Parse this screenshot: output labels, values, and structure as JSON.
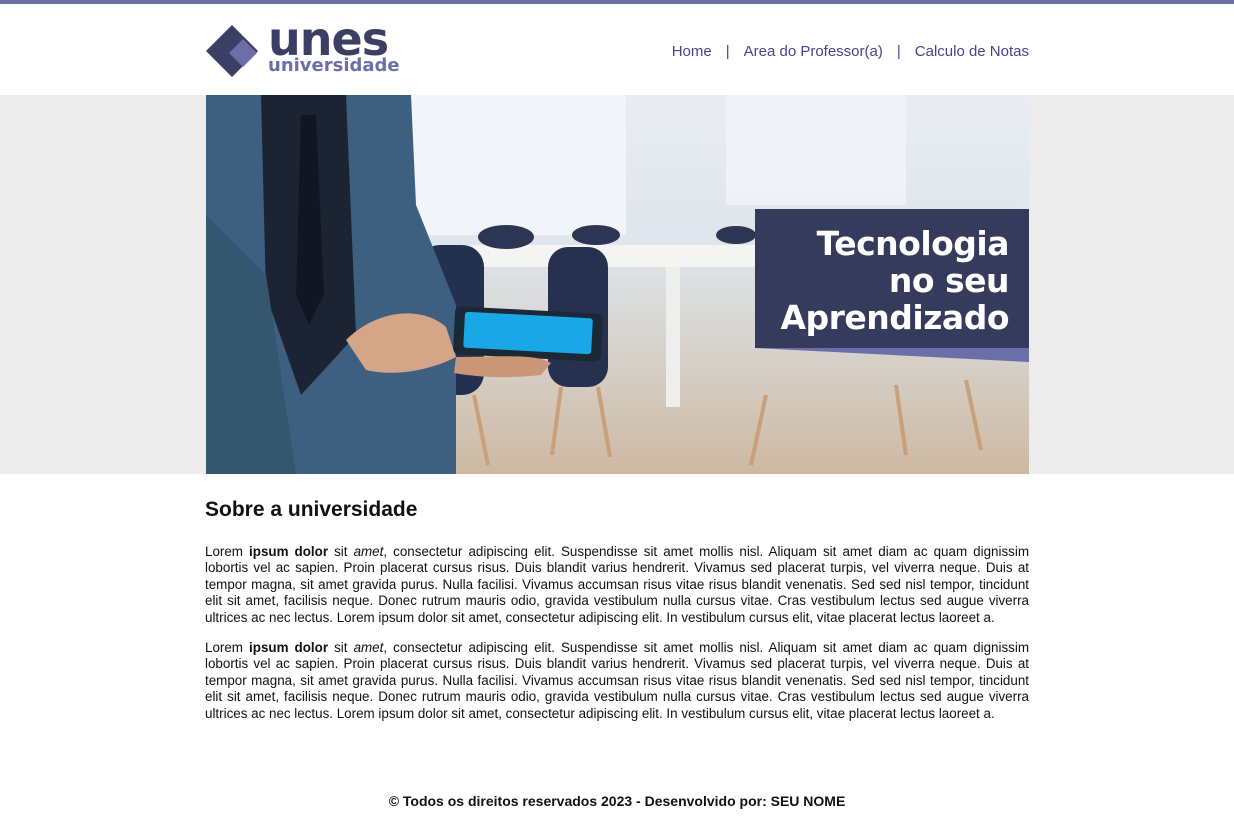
{
  "logo": {
    "word": "unes",
    "sub": "universidade",
    "colors": {
      "dark": "#3a3f63",
      "light": "#6b6fa8"
    }
  },
  "nav": {
    "items": [
      {
        "label": "Home"
      },
      {
        "label": "Area do Professor(a)"
      },
      {
        "label": "Calculo de Notas"
      }
    ],
    "separator": "|"
  },
  "hero": {
    "alt": "Homem de terno segurando um tablet em uma sala de reuniões",
    "title_lines": [
      "Tecnologia",
      "no seu",
      "Aprendizado"
    ],
    "banner_color": "#353b5c"
  },
  "about": {
    "title": "Sobre a universidade",
    "paragraphs": [
      {
        "lead": "Lorem ",
        "bold": "ipsum dolor",
        "mid": " sit ",
        "italic": "amet",
        "rest": ", consectetur adipiscing elit. Suspendisse sit amet mollis nisl. Aliquam sit amet diam ac quam dignissim lobortis vel ac sapien. Proin placerat cursus risus. Duis blandit varius hendrerit. Vivamus sed placerat turpis, vel viverra neque. Duis at tempor magna, sit amet gravida purus. Nulla facilisi. Vivamus accumsan risus vitae risus blandit venenatis. Sed sed nisl tempor, tincidunt elit sit amet, facilisis neque. Donec rutrum mauris odio, gravida vestibulum nulla cursus vitae. Cras vestibulum lectus sed augue viverra ultrices ac nec lectus. Lorem ipsum dolor sit amet, consectetur adipiscing elit. In vestibulum cursus elit, vitae placerat lectus laoreet a."
      },
      {
        "lead": "Lorem ",
        "bold": "ipsum dolor",
        "mid": " sit ",
        "italic": "amet",
        "rest": ", consectetur adipiscing elit. Suspendisse sit amet mollis nisl. Aliquam sit amet diam ac quam dignissim lobortis vel ac sapien. Proin placerat cursus risus. Duis blandit varius hendrerit. Vivamus sed placerat turpis, vel viverra neque. Duis at tempor magna, sit amet gravida purus. Nulla facilisi. Vivamus accumsan risus vitae risus blandit venenatis. Sed sed nisl tempor, tincidunt elit sit amet, facilisis neque. Donec rutrum mauris odio, gravida vestibulum nulla cursus vitae. Cras vestibulum lectus sed augue viverra ultrices ac nec lectus. Lorem ipsum dolor sit amet, consectetur adipiscing elit. In vestibulum cursus elit, vitae placerat lectus laoreet a."
      }
    ]
  },
  "footer": {
    "text": "© Todos os direitos reservados 2023 - Desenvolvido por: SEU NOME"
  },
  "theme": {
    "accent": "#6b6fa8",
    "nav_link": "#4b3f8a",
    "hero_band": "#ececec"
  }
}
